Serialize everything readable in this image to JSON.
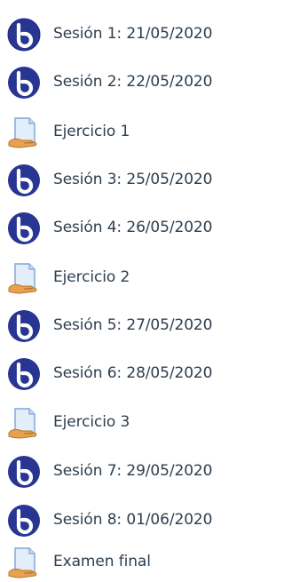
{
  "activities": [
    {
      "type": "bigbluebutton",
      "icon": "bigbluebutton-icon",
      "label": "Sesión 1: 21/05/2020"
    },
    {
      "type": "bigbluebutton",
      "icon": "bigbluebutton-icon",
      "label": "Sesión 2: 22/05/2020"
    },
    {
      "type": "assignment",
      "icon": "assignment-icon",
      "label": "Ejercicio 1"
    },
    {
      "type": "bigbluebutton",
      "icon": "bigbluebutton-icon",
      "label": "Sesión 3: 25/05/2020"
    },
    {
      "type": "bigbluebutton",
      "icon": "bigbluebutton-icon",
      "label": "Sesión 4: 26/05/2020"
    },
    {
      "type": "assignment",
      "icon": "assignment-icon",
      "label": "Ejercicio 2"
    },
    {
      "type": "bigbluebutton",
      "icon": "bigbluebutton-icon",
      "label": "Sesión 5: 27/05/2020"
    },
    {
      "type": "bigbluebutton",
      "icon": "bigbluebutton-icon",
      "label": "Sesión 6: 28/05/2020"
    },
    {
      "type": "assignment",
      "icon": "assignment-icon",
      "label": "Ejercicio 3"
    },
    {
      "type": "bigbluebutton",
      "icon": "bigbluebutton-icon",
      "label": "Sesión 7: 29/05/2020"
    },
    {
      "type": "bigbluebutton",
      "icon": "bigbluebutton-icon",
      "label": "Sesión 8: 01/06/2020"
    },
    {
      "type": "assignment",
      "icon": "assignment-icon",
      "label": "Examen final"
    }
  ],
  "colors": {
    "text": "#2d3e4e",
    "bbb_circle": "#283593",
    "paper": "#e3eefb",
    "paper_edge": "#7ea3d8",
    "hand": "#e8a24f"
  }
}
